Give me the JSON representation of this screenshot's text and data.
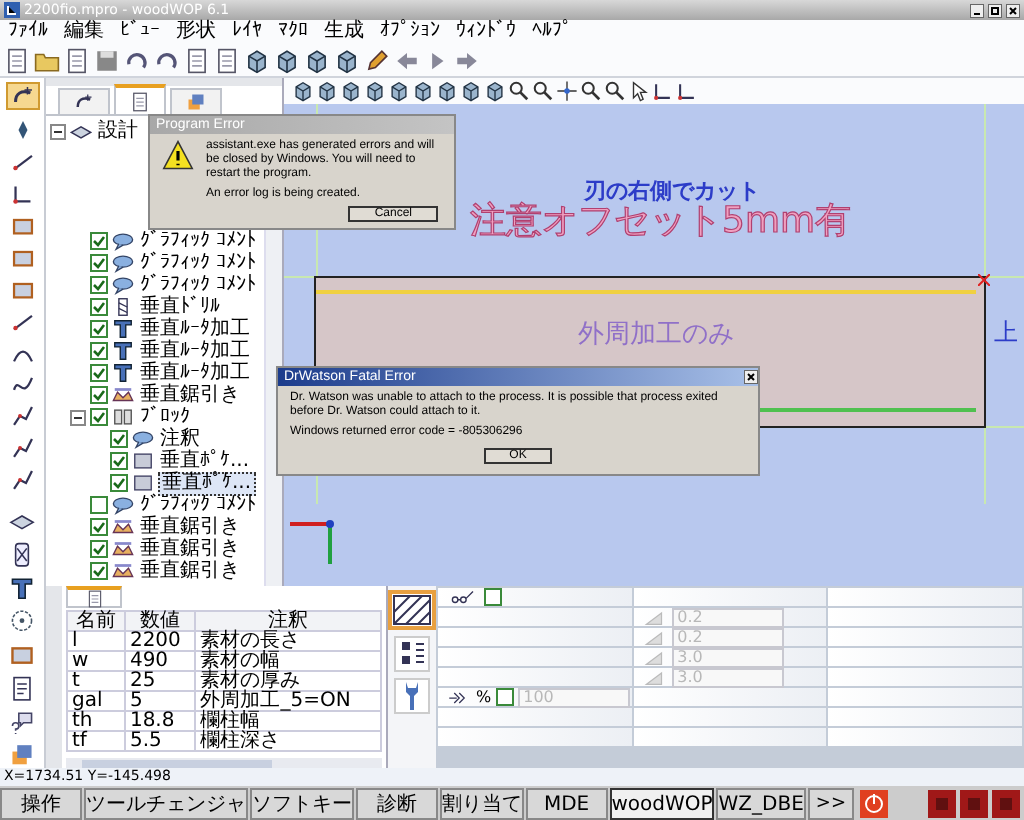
{
  "window": {
    "title": "2200fio.mpro - woodWOP 6.1"
  },
  "menu": [
    "ﾌｧｲﾙ",
    "編集",
    "ﾋﾞｭｰ",
    "形状",
    "ﾚｲﾔ",
    "ﾏｸﾛ",
    "生成",
    "ｵﾌﾟｼｮﾝ",
    "ｳｨﾝﾄﾞｳ",
    "ﾍﾙﾌﾟ"
  ],
  "tree": {
    "label": "設計",
    "kind": "board",
    "selected": false,
    "expanded": true,
    "children": [
      {
        "label": "ｸﾞﾗﾌｨｯｸ ｺﾒﾝﾄ",
        "kind": "comment",
        "checked": true,
        "selected": false
      },
      {
        "label": "ｸﾞﾗﾌｨｯｸ ｺﾒﾝﾄ",
        "kind": "comment",
        "checked": true,
        "selected": false
      },
      {
        "label": "ｸﾞﾗﾌｨｯｸ ｺﾒﾝﾄ",
        "kind": "comment",
        "checked": true,
        "selected": false
      },
      {
        "label": "垂直ﾄﾞﾘﾙ",
        "kind": "drill",
        "checked": true,
        "selected": false
      },
      {
        "label": "垂直ﾙｰﾀ加工",
        "kind": "router",
        "checked": true,
        "selected": false
      },
      {
        "label": "垂直ﾙｰﾀ加工",
        "kind": "router",
        "checked": true,
        "selected": false
      },
      {
        "label": "垂直ﾙｰﾀ加工",
        "kind": "router",
        "checked": true,
        "selected": false
      },
      {
        "label": "垂直鋸引き",
        "kind": "saw",
        "checked": true,
        "selected": false
      },
      {
        "label": "ﾌﾞﾛｯｸ",
        "kind": "block",
        "checked": true,
        "selected": false,
        "expanded": true,
        "children": [
          {
            "label": "注釈",
            "kind": "comment",
            "checked": true,
            "selected": false
          },
          {
            "label": "垂直ﾎﾟｹ...",
            "kind": "pocket",
            "checked": true,
            "selected": false
          },
          {
            "label": "垂直ﾎﾟｹ...",
            "kind": "pocket",
            "checked": true,
            "selected": true
          }
        ]
      },
      {
        "label": "ｸﾞﾗﾌｨｯｸ ｺﾒﾝﾄ",
        "kind": "comment",
        "checked": false,
        "selected": false
      },
      {
        "label": "垂直鋸引き",
        "kind": "saw",
        "checked": true,
        "selected": false
      },
      {
        "label": "垂直鋸引き",
        "kind": "saw",
        "checked": true,
        "selected": false
      },
      {
        "label": "垂直鋸引き",
        "kind": "saw",
        "checked": true,
        "selected": false
      }
    ]
  },
  "panel_tabs": [
    {
      "selected": false
    },
    {
      "selected": true
    },
    {
      "selected": false
    }
  ],
  "canvas": {
    "blade_note": "刃の右側でカット",
    "offset_note": "注意オフセット5mm有",
    "area_note": "外周加工のみ",
    "side_label": "上"
  },
  "dialogs": [
    {
      "title": "Program Error",
      "kind": "warning",
      "lines": [
        "assistant.exe has generated errors and will be closed by Windows. You will need to restart the program.",
        "An error log is being created."
      ],
      "button": "Cancel"
    },
    {
      "title": "DrWatson Fatal Error",
      "kind": "plain",
      "lines": [
        "Dr. Watson was unable to attach to the process. It is possible that process exited before Dr. Watson could attach to it.",
        "Windows returned error code = -805306296"
      ],
      "button": "OK"
    }
  ],
  "variables": {
    "columns": [
      "名前",
      "数値",
      "注釈"
    ],
    "rows": [
      [
        "l",
        "2200",
        "素材の長さ"
      ],
      [
        "w",
        "490",
        "素材の幅"
      ],
      [
        "t",
        "25",
        "素材の厚み"
      ],
      [
        "gal",
        "5",
        "外周加工_5=ON"
      ],
      [
        "th",
        "18.8",
        "欄柱幅"
      ],
      [
        "tf",
        "5.5",
        "欄柱深さ"
      ]
    ]
  },
  "parameters": {
    "tool_checked": false,
    "feed": {
      "unit": "%",
      "checked": false,
      "value": "100",
      "disabled": true
    },
    "offset_fields": [
      {
        "value": "0.2",
        "disabled": true
      },
      {
        "value": "0.2",
        "disabled": true
      },
      {
        "value": "3.0",
        "disabled": true
      },
      {
        "value": "3.0",
        "disabled": true
      }
    ]
  },
  "status_bar": {
    "coordinates": "X=1734.51 Y=-145.498"
  },
  "taskbar": [
    {
      "label": "操作",
      "selected": false
    },
    {
      "label": "ツールチェンジャ",
      "selected": false
    },
    {
      "label": "ソフトキー",
      "selected": false
    },
    {
      "label": "診断",
      "selected": false
    },
    {
      "label": "割り当て",
      "selected": false
    },
    {
      "label": "MDE",
      "selected": false
    },
    {
      "label": "woodWOP",
      "selected": true
    },
    {
      "label": "WZ_DBE",
      "selected": false
    }
  ],
  "taskbar_more": ">>"
}
